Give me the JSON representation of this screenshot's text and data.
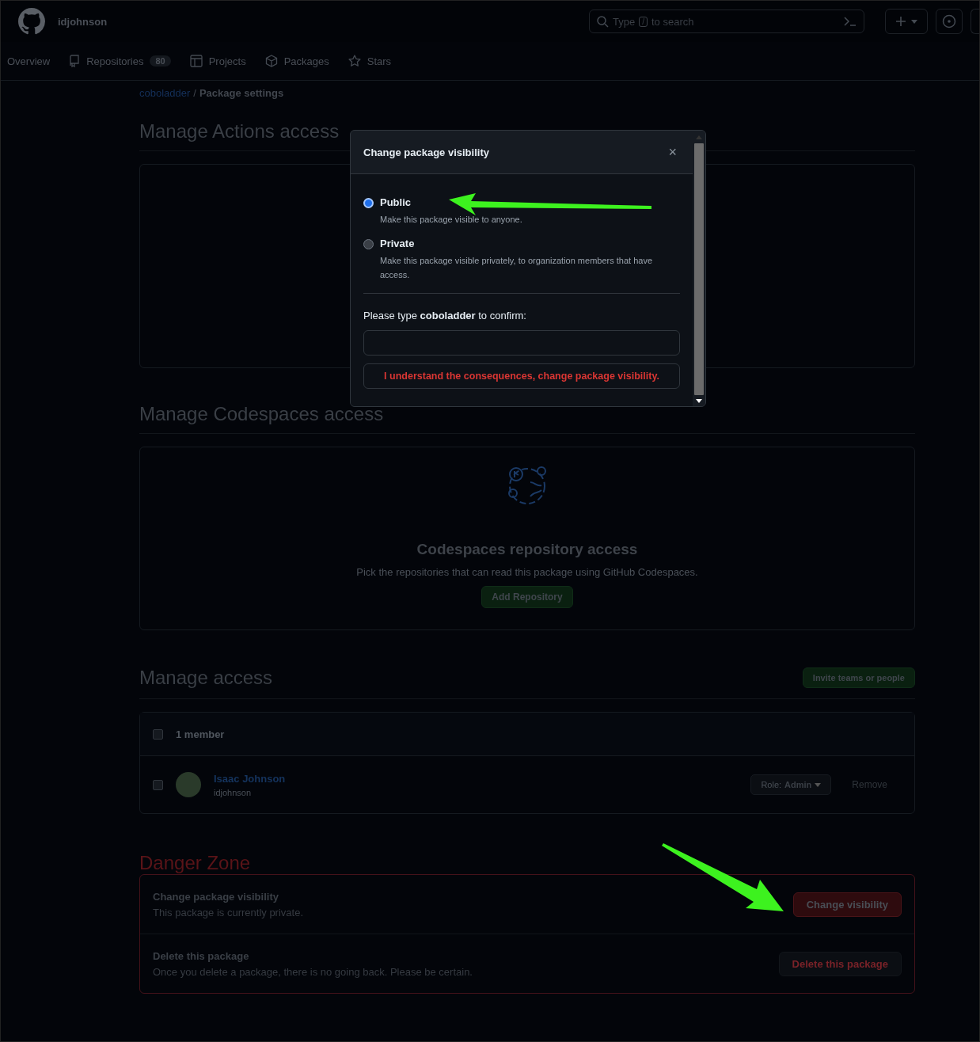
{
  "header": {
    "username": "idjohnson",
    "search": {
      "placeholder_before": "Type",
      "key": "/",
      "placeholder_after": "to search"
    }
  },
  "nav": [
    {
      "label": "Overview"
    },
    {
      "label": "Repositories",
      "count": "80"
    },
    {
      "label": "Projects"
    },
    {
      "label": "Packages"
    },
    {
      "label": "Stars"
    }
  ],
  "breadcrumb": {
    "link": "coboladder",
    "separator": "/",
    "current": "Package settings"
  },
  "actions_section": {
    "title": "Manage Actions access"
  },
  "codespaces_section": {
    "title": "Manage Codespaces access",
    "card_title": "Codespaces repository access",
    "card_text": "Pick the repositories that can read this package using GitHub Codespaces.",
    "button": "Add Repository"
  },
  "access_section": {
    "title": "Manage access",
    "invite_button": "Invite teams or people",
    "header": {
      "label": "1 member",
      "checked": false
    },
    "members": [
      {
        "name": "Isaac Johnson",
        "handle": "idjohnson",
        "checked": false,
        "role_label": "Role:",
        "role": "Admin",
        "remove": "Remove"
      }
    ]
  },
  "danger_zone": {
    "title": "Danger Zone",
    "items": [
      {
        "title": "Change package visibility",
        "text": "This package is currently private.",
        "button": "Change visibility",
        "highlighted": true
      },
      {
        "title": "Delete this package",
        "text": "Once you delete a package, there is no going back. Please be certain.",
        "button": "Delete this package",
        "highlighted": false
      }
    ]
  },
  "dialog": {
    "title": "Change package visibility",
    "close": "×",
    "options": [
      {
        "label": "Public",
        "description": "Make this package visible to anyone.",
        "selected": true
      },
      {
        "label": "Private",
        "description": "Make this package visible privately, to organization members that have access.",
        "selected": false
      }
    ],
    "confirm_text": "Please type **coboladder** to confirm:",
    "confirm_button": "I understand the consequences, change package visibility."
  }
}
